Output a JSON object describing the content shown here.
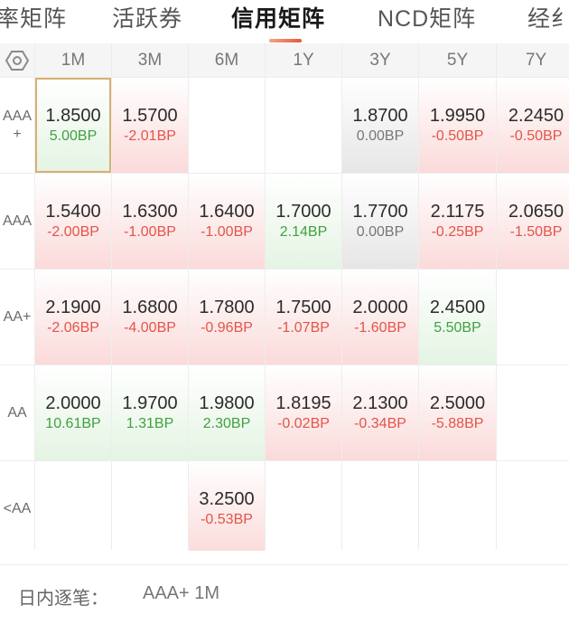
{
  "tabs": [
    {
      "label": "率矩阵"
    },
    {
      "label": "活跃券"
    },
    {
      "label": "信用矩阵"
    },
    {
      "label": "NCD矩阵"
    },
    {
      "label": "经纟"
    }
  ],
  "matrix": {
    "settings_icon": "hexagon-gear-icon",
    "columns": [
      "1M",
      "3M",
      "6M",
      "1Y",
      "3Y",
      "5Y",
      "7Y"
    ],
    "rows": [
      {
        "label": "AAA\n+",
        "cells": [
          {
            "rate": "1.8500",
            "chg": "5.00BP",
            "dir": "up",
            "selected": true
          },
          {
            "rate": "1.5700",
            "chg": "-2.01BP",
            "dir": "down"
          },
          {
            "rate": "",
            "chg": "",
            "dir": "none"
          },
          {
            "rate": "",
            "chg": "",
            "dir": "none"
          },
          {
            "rate": "1.8700",
            "chg": "0.00BP",
            "dir": "flat"
          },
          {
            "rate": "1.9950",
            "chg": "-0.50BP",
            "dir": "down"
          },
          {
            "rate": "2.2450",
            "chg": "-0.50BP",
            "dir": "down"
          }
        ]
      },
      {
        "label": "AAA",
        "cells": [
          {
            "rate": "1.5400",
            "chg": "-2.00BP",
            "dir": "down"
          },
          {
            "rate": "1.6300",
            "chg": "-1.00BP",
            "dir": "down"
          },
          {
            "rate": "1.6400",
            "chg": "-1.00BP",
            "dir": "down"
          },
          {
            "rate": "1.7000",
            "chg": "2.14BP",
            "dir": "up"
          },
          {
            "rate": "1.7700",
            "chg": "0.00BP",
            "dir": "flat"
          },
          {
            "rate": "2.1175",
            "chg": "-0.25BP",
            "dir": "down"
          },
          {
            "rate": "2.0650",
            "chg": "-1.50BP",
            "dir": "down"
          }
        ]
      },
      {
        "label": "AA+",
        "cells": [
          {
            "rate": "2.1900",
            "chg": "-2.06BP",
            "dir": "down"
          },
          {
            "rate": "1.6800",
            "chg": "-4.00BP",
            "dir": "down"
          },
          {
            "rate": "1.7800",
            "chg": "-0.96BP",
            "dir": "down"
          },
          {
            "rate": "1.7500",
            "chg": "-1.07BP",
            "dir": "down"
          },
          {
            "rate": "2.0000",
            "chg": "-1.60BP",
            "dir": "down"
          },
          {
            "rate": "2.4500",
            "chg": "5.50BP",
            "dir": "up"
          },
          {
            "rate": "",
            "chg": "",
            "dir": "none"
          }
        ]
      },
      {
        "label": "AA",
        "cells": [
          {
            "rate": "2.0000",
            "chg": "10.61BP",
            "dir": "up"
          },
          {
            "rate": "1.9700",
            "chg": "1.31BP",
            "dir": "up"
          },
          {
            "rate": "1.9800",
            "chg": "2.30BP",
            "dir": "up"
          },
          {
            "rate": "1.8195",
            "chg": "-0.02BP",
            "dir": "down"
          },
          {
            "rate": "2.1300",
            "chg": "-0.34BP",
            "dir": "down"
          },
          {
            "rate": "2.5000",
            "chg": "-5.88BP",
            "dir": "down"
          },
          {
            "rate": "",
            "chg": "",
            "dir": "none"
          }
        ]
      },
      {
        "label": "<AA",
        "cells": [
          {
            "rate": "",
            "chg": "",
            "dir": "none"
          },
          {
            "rate": "",
            "chg": "",
            "dir": "none"
          },
          {
            "rate": "3.2500",
            "chg": "-0.53BP",
            "dir": "down"
          },
          {
            "rate": "",
            "chg": "",
            "dir": "none"
          },
          {
            "rate": "",
            "chg": "",
            "dir": "none"
          },
          {
            "rate": "",
            "chg": "",
            "dir": "none"
          },
          {
            "rate": "",
            "chg": "",
            "dir": "none"
          }
        ]
      }
    ]
  },
  "footer": {
    "label": "日内逐笔：",
    "value": "AAA+ 1M"
  },
  "colors": {
    "accent": "#e8573a",
    "up": "#3fa140",
    "down": "#e25547",
    "selected_border": "#d7b072"
  }
}
